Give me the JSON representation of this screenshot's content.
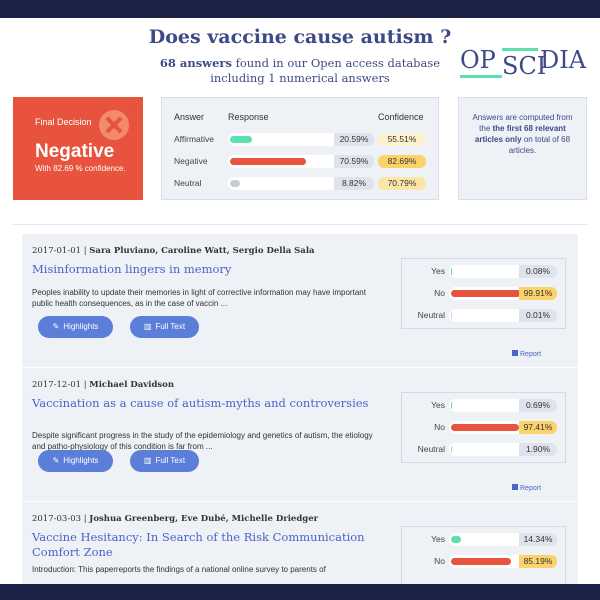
{
  "header": {
    "question": "Does vaccine cause autism ?",
    "summary_count": "68 answers",
    "summary_rest_line1": " found in our Open access database",
    "summary_line2": "including 1 numerical answers"
  },
  "logo": {
    "part1": "OP",
    "part2": "SCI",
    "part3": "DIA"
  },
  "decision": {
    "label": "Final Decision",
    "value": "Negative",
    "confidence_text": "With 82.69 % confidence."
  },
  "response_table": {
    "headers": {
      "answer": "Answer",
      "response": "Response",
      "confidence": "Confidence"
    },
    "rows": [
      {
        "label": "Affirmative",
        "percent": "20.59%",
        "confidence": "55.51%",
        "fraction": 0.2059,
        "color": "#5ce0b0",
        "conf_color": "#fdf1d0"
      },
      {
        "label": "Negative",
        "percent": "70.59%",
        "confidence": "82.69%",
        "fraction": 0.7059,
        "color": "#e8533e",
        "conf_color": "#fbd36a"
      },
      {
        "label": "Neutral",
        "percent": "8.82%",
        "confidence": "70.79%",
        "fraction": 0.0882,
        "color": "#c8cdd8",
        "conf_color": "#fbe6a6"
      }
    ]
  },
  "note": {
    "line1": "Answers are computed from the ",
    "bold": "the first 68 relevant articles only",
    "line2": " on total of 68 articles."
  },
  "buttons": {
    "highlights": "Highlights",
    "full_text": "Full Text",
    "report": "Report"
  },
  "articles": [
    {
      "date": "2017-01-01",
      "authors": "Sara Pluviano, Caroline Watt, Sergio Della Sala",
      "title": "Misinformation lingers in memory",
      "abstract": "Peoples inability to update their memories in light of corrective information may have important public health consequences, as in the case of vaccin ...",
      "responses": [
        {
          "label": "Yes",
          "percent": "0.08%",
          "fraction": 0.0008,
          "color": "#5ce0b0"
        },
        {
          "label": "No",
          "percent": "99.91%",
          "fraction": 0.9991,
          "color": "#e8533e"
        },
        {
          "label": "Neutral",
          "percent": "0.01%",
          "fraction": 0.0001,
          "color": "#c8cdd8"
        }
      ]
    },
    {
      "date": "2017-12-01",
      "authors": "Michael Davidson",
      "title": "Vaccination as a cause of autism-myths and controversies",
      "abstract": "Despite significant progress in the study of the epidemiology and genetics of autism, the etiology and patho-physiology of this condition is far from ...",
      "responses": [
        {
          "label": "Yes",
          "percent": "0.69%",
          "fraction": 0.0069,
          "color": "#5ce0b0"
        },
        {
          "label": "No",
          "percent": "97.41%",
          "fraction": 0.9741,
          "color": "#e8533e"
        },
        {
          "label": "Neutral",
          "percent": "1.90%",
          "fraction": 0.019,
          "color": "#c8cdd8"
        }
      ]
    },
    {
      "date": "2017-03-03",
      "authors": "Joshua Greenberg, Eve Dubé, Michelle Driedger",
      "title": "Vaccine Hesitancy: In Search of the Risk Communication Comfort Zone",
      "abstract": "Introduction: This paperreports the findings of a national online survey to parents of",
      "responses": [
        {
          "label": "Yes",
          "percent": "14.34%",
          "fraction": 0.1434,
          "color": "#5ce0b0"
        },
        {
          "label": "No",
          "percent": "85.19%",
          "fraction": 0.8519,
          "color": "#e8533e"
        }
      ]
    }
  ]
}
